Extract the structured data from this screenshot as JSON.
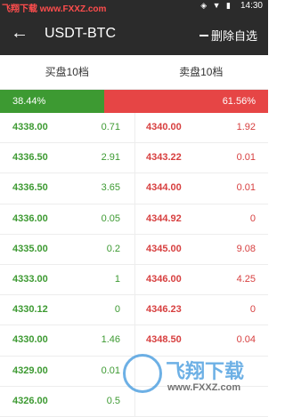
{
  "status": {
    "watermark": "飞翔下载 www.FXXZ.com",
    "time": "14:30"
  },
  "toolbar": {
    "title": "USDT-BTC",
    "remove_label": "删除自选"
  },
  "tabs": [
    "买盘10档",
    "卖盘10档"
  ],
  "ratio": {
    "buy": "38.44%",
    "sell": "61.56%"
  },
  "orders": [
    {
      "bid_price": "4338.00",
      "bid_qty": "0.71",
      "ask_price": "4340.00",
      "ask_qty": "1.92"
    },
    {
      "bid_price": "4336.50",
      "bid_qty": "2.91",
      "ask_price": "4343.22",
      "ask_qty": "0.01"
    },
    {
      "bid_price": "4336.50",
      "bid_qty": "3.65",
      "ask_price": "4344.00",
      "ask_qty": "0.01"
    },
    {
      "bid_price": "4336.00",
      "bid_qty": "0.05",
      "ask_price": "4344.92",
      "ask_qty": "0"
    },
    {
      "bid_price": "4335.00",
      "bid_qty": "0.2",
      "ask_price": "4345.00",
      "ask_qty": "9.08"
    },
    {
      "bid_price": "4333.00",
      "bid_qty": "1",
      "ask_price": "4346.00",
      "ask_qty": "4.25"
    },
    {
      "bid_price": "4330.12",
      "bid_qty": "0",
      "ask_price": "4346.23",
      "ask_qty": "0"
    },
    {
      "bid_price": "4330.00",
      "bid_qty": "1.46",
      "ask_price": "4348.50",
      "ask_qty": "0.04"
    },
    {
      "bid_price": "4329.00",
      "bid_qty": "0.01",
      "ask_price": "",
      "ask_qty": ""
    },
    {
      "bid_price": "4326.00",
      "bid_qty": "0.5",
      "ask_price": "",
      "ask_qty": ""
    }
  ],
  "watermark2": {
    "main": "飞翔下载",
    "sub": "www.FXXZ.com"
  },
  "colors": {
    "bid": "#3d9a32",
    "ask": "#d73f3f",
    "toolbar": "#2b2b2b"
  }
}
